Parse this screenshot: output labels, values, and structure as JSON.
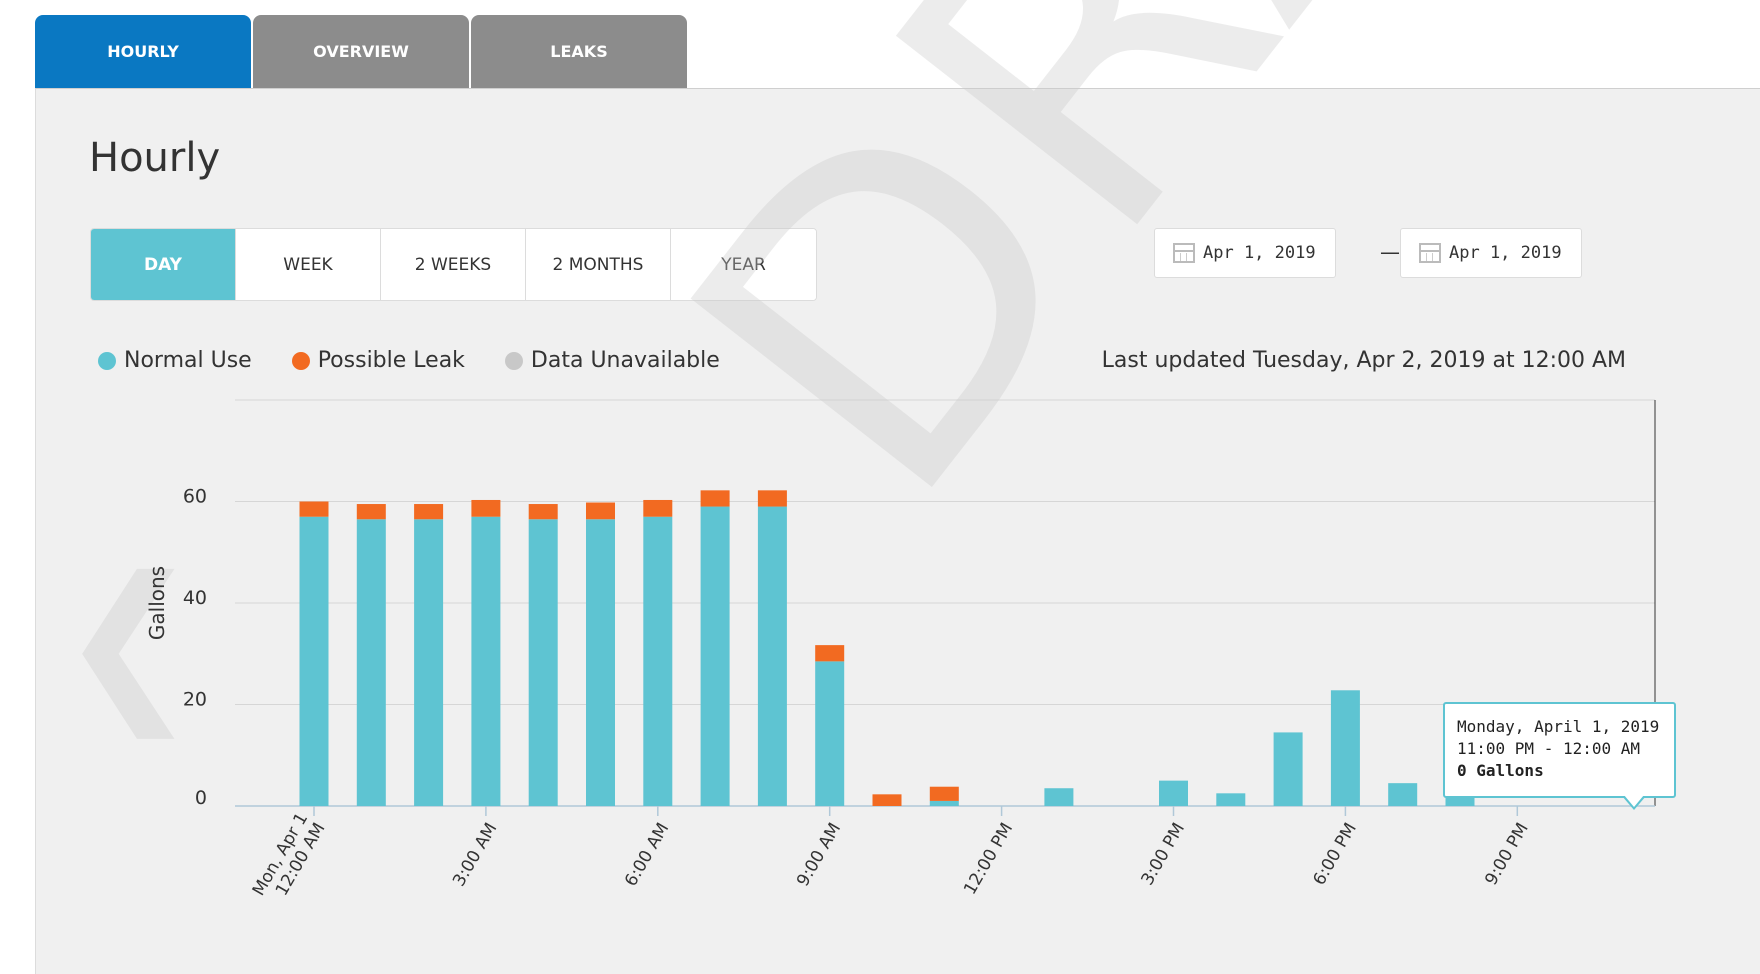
{
  "tabs": [
    {
      "label": "HOURLY",
      "active": true
    },
    {
      "label": "OVERVIEW",
      "active": false
    },
    {
      "label": "LEAKS",
      "active": false
    }
  ],
  "page_title": "Hourly",
  "range_buttons": [
    {
      "label": "DAY",
      "active": true
    },
    {
      "label": "WEEK",
      "active": false
    },
    {
      "label": "2 WEEKS",
      "active": false
    },
    {
      "label": "2 MONTHS",
      "active": false
    },
    {
      "label": "YEAR",
      "active": false
    }
  ],
  "date_range": {
    "start": "Apr 1, 2019",
    "separator": "—",
    "end": "Apr 1, 2019"
  },
  "legend": [
    {
      "label": "Normal Use",
      "color": "#5ec4d2"
    },
    {
      "label": "Possible Leak",
      "color": "#f26a21"
    },
    {
      "label": "Data Unavailable",
      "color": "#c8c8c8"
    }
  ],
  "last_updated": "Last updated Tuesday, Apr 2, 2019 at 12:00 AM",
  "watermark": "DRAFT",
  "nav_prev_glyph": "❮",
  "tooltip": {
    "line1": "Monday, April 1, 2019",
    "line2": "11:00 PM - 12:00 AM",
    "line3": "0 Gallons"
  },
  "colors": {
    "normal": "#5ec4d2",
    "leak": "#f26a21",
    "accent": "#0a78c2"
  },
  "chart_data": {
    "type": "bar",
    "stacked": true,
    "ylabel": "Gallons",
    "ylim": [
      0,
      80
    ],
    "yticks": [
      0,
      20,
      40,
      60
    ],
    "categories": [
      "12 AM",
      "1 AM",
      "2 AM",
      "3 AM",
      "4 AM",
      "5 AM",
      "6 AM",
      "7 AM",
      "8 AM",
      "9 AM",
      "10 AM",
      "11 AM",
      "12 PM",
      "1 PM",
      "2 PM",
      "3 PM",
      "4 PM",
      "5 PM",
      "6 PM",
      "7 PM",
      "8 PM",
      "9 PM",
      "10 PM",
      "11 PM"
    ],
    "x_tick_labels": [
      {
        "hour": 0,
        "lines": [
          "Mon, Apr 1",
          "12:00 AM"
        ]
      },
      {
        "hour": 3,
        "lines": [
          "3:00 AM"
        ]
      },
      {
        "hour": 6,
        "lines": [
          "6:00 AM"
        ]
      },
      {
        "hour": 9,
        "lines": [
          "9:00 AM"
        ]
      },
      {
        "hour": 12,
        "lines": [
          "12:00 PM"
        ]
      },
      {
        "hour": 15,
        "lines": [
          "3:00 PM"
        ]
      },
      {
        "hour": 18,
        "lines": [
          "6:00 PM"
        ]
      },
      {
        "hour": 21,
        "lines": [
          "9:00 PM"
        ]
      }
    ],
    "series": [
      {
        "name": "Normal Use",
        "values": [
          57,
          56.5,
          56.5,
          57,
          56.5,
          56.5,
          57,
          59,
          59,
          28.5,
          0,
          1,
          0,
          3.5,
          0,
          5,
          2.5,
          14.5,
          22.8,
          4.5,
          3,
          0,
          0,
          0
        ]
      },
      {
        "name": "Possible Leak",
        "values": [
          3,
          3,
          3,
          3.3,
          3,
          3.3,
          3.3,
          3.2,
          3.2,
          3.2,
          2.3,
          2.8,
          0,
          0,
          0,
          0,
          0,
          0,
          0,
          0,
          0,
          0,
          0,
          0
        ]
      }
    ]
  }
}
